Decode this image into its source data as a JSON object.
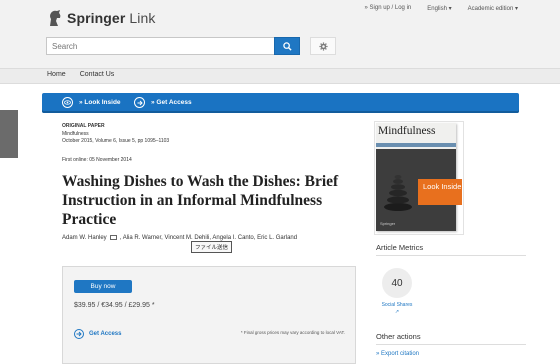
{
  "header": {
    "logo_text": "Springer",
    "logo_text_light": "Link",
    "top_links": [
      "» Sign up / Log in",
      "English",
      "Academic edition"
    ],
    "search_placeholder": "Search"
  },
  "nav": {
    "items": [
      "Home",
      "Contact Us"
    ]
  },
  "action_bar": {
    "look_inside": "» Look Inside",
    "get_access": "» Get Access"
  },
  "article": {
    "type": "ORIGINAL PAPER",
    "journal": "Mindfulness",
    "issue_info": "October 2015, Volume 6, Issue 5, pp 1095–1103",
    "first_online": "First online: 05 November 2014",
    "title": "Washing Dishes to Wash the Dishes: Brief Instruction in an Informal Mindfulness Practice",
    "author_first": "Adam W. Hanley",
    "authors_rest": ", Alia R. Warner, Vincent M. Dehili, Angela I. Canto, Eric L. Garland",
    "tooltip": "ファイル送信"
  },
  "purchase": {
    "buy_label": "Buy now",
    "prices": "$39.95 / €34.95 / £29.95 *",
    "get_access": "Get Access",
    "vat_note": "* Final gross prices may vary according to local VAT."
  },
  "sidebar": {
    "cover_title": "Mindfulness",
    "cover_brand": "Springer",
    "look_inside": "Look Inside",
    "metrics_title": "Article Metrics",
    "metric_value": "40",
    "metric_label": "Social Shares",
    "other_title": "Other actions",
    "export_label": "» Export citation"
  },
  "colors": {
    "brand_blue": "#1f77c3",
    "accent_orange": "#e8701e"
  }
}
